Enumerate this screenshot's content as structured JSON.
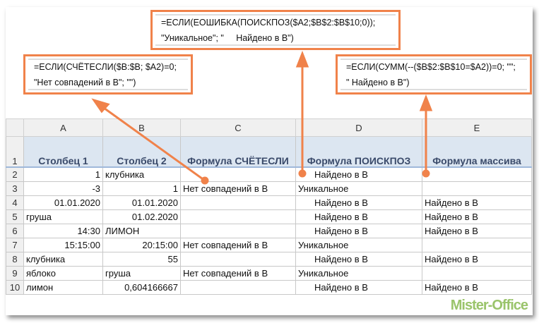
{
  "callouts": {
    "countif": [
      "=ЕСЛИ(СЧЁТЕСЛИ($B:$B; $A2)=0;",
      "\"Нет совпадений в В\"; \"\")"
    ],
    "match": [
      "=ЕСЛИ(ЕОШИБКА(ПОИСКПОЗ($A2;$B$2:$B$10;0));",
      "\"Уникальное\"; \"     Найдено в В\")"
    ],
    "array": [
      "=ЕСЛИ(СУММ(--($B$2:$B$10=$A2))=0; \"\";",
      "\" Найдено в В\")"
    ]
  },
  "columns": [
    "A",
    "B",
    "C",
    "D",
    "E"
  ],
  "headers": [
    "Столбец 1",
    "Столбец 2",
    "Формула СЧЁТЕСЛИ",
    "Формула ПОИСКПОЗ",
    "Формула массива"
  ],
  "rows": [
    {
      "n": "1"
    },
    {
      "n": "2",
      "a": "1",
      "b": "клубника",
      "c": "",
      "d": "Найдено в В",
      "e": ""
    },
    {
      "n": "3",
      "a": "-3",
      "b": "1",
      "c": "Нет совпадений в В",
      "d": "Уникальное",
      "e": ""
    },
    {
      "n": "4",
      "a": "01.01.2020",
      "b": "01.01.2020",
      "c": "",
      "d": "Найдено в В",
      "e": "Найдено в В"
    },
    {
      "n": "5",
      "a": "груша",
      "b": "01.02.2020",
      "c": "",
      "d": "Найдено в В",
      "e": "Найдено в В"
    },
    {
      "n": "6",
      "a": "14:30",
      "b": "ЛИМОН",
      "c": "",
      "d": "Найдено в В",
      "e": "Найдено в В"
    },
    {
      "n": "7",
      "a": "15:15:00",
      "b": "20:15:00",
      "c": "Нет совпадений в В",
      "d": "Уникальное",
      "e": ""
    },
    {
      "n": "8",
      "a": "клубника",
      "b": "55",
      "c": "",
      "d": "Найдено в В",
      "e": "Найдено в В"
    },
    {
      "n": "9",
      "a": "яблоко",
      "b": "груша",
      "c": "Нет совпадений в В",
      "d": "Уникальное",
      "e": ""
    },
    {
      "n": "10",
      "a": "лимон",
      "b": "0,604166667",
      "c": "",
      "d": "Найдено в В",
      "e": "Найдено в В"
    }
  ],
  "logo": "Mister-Office",
  "colors": {
    "accent": "#f0824a",
    "header_fill": "#dce6f1"
  }
}
